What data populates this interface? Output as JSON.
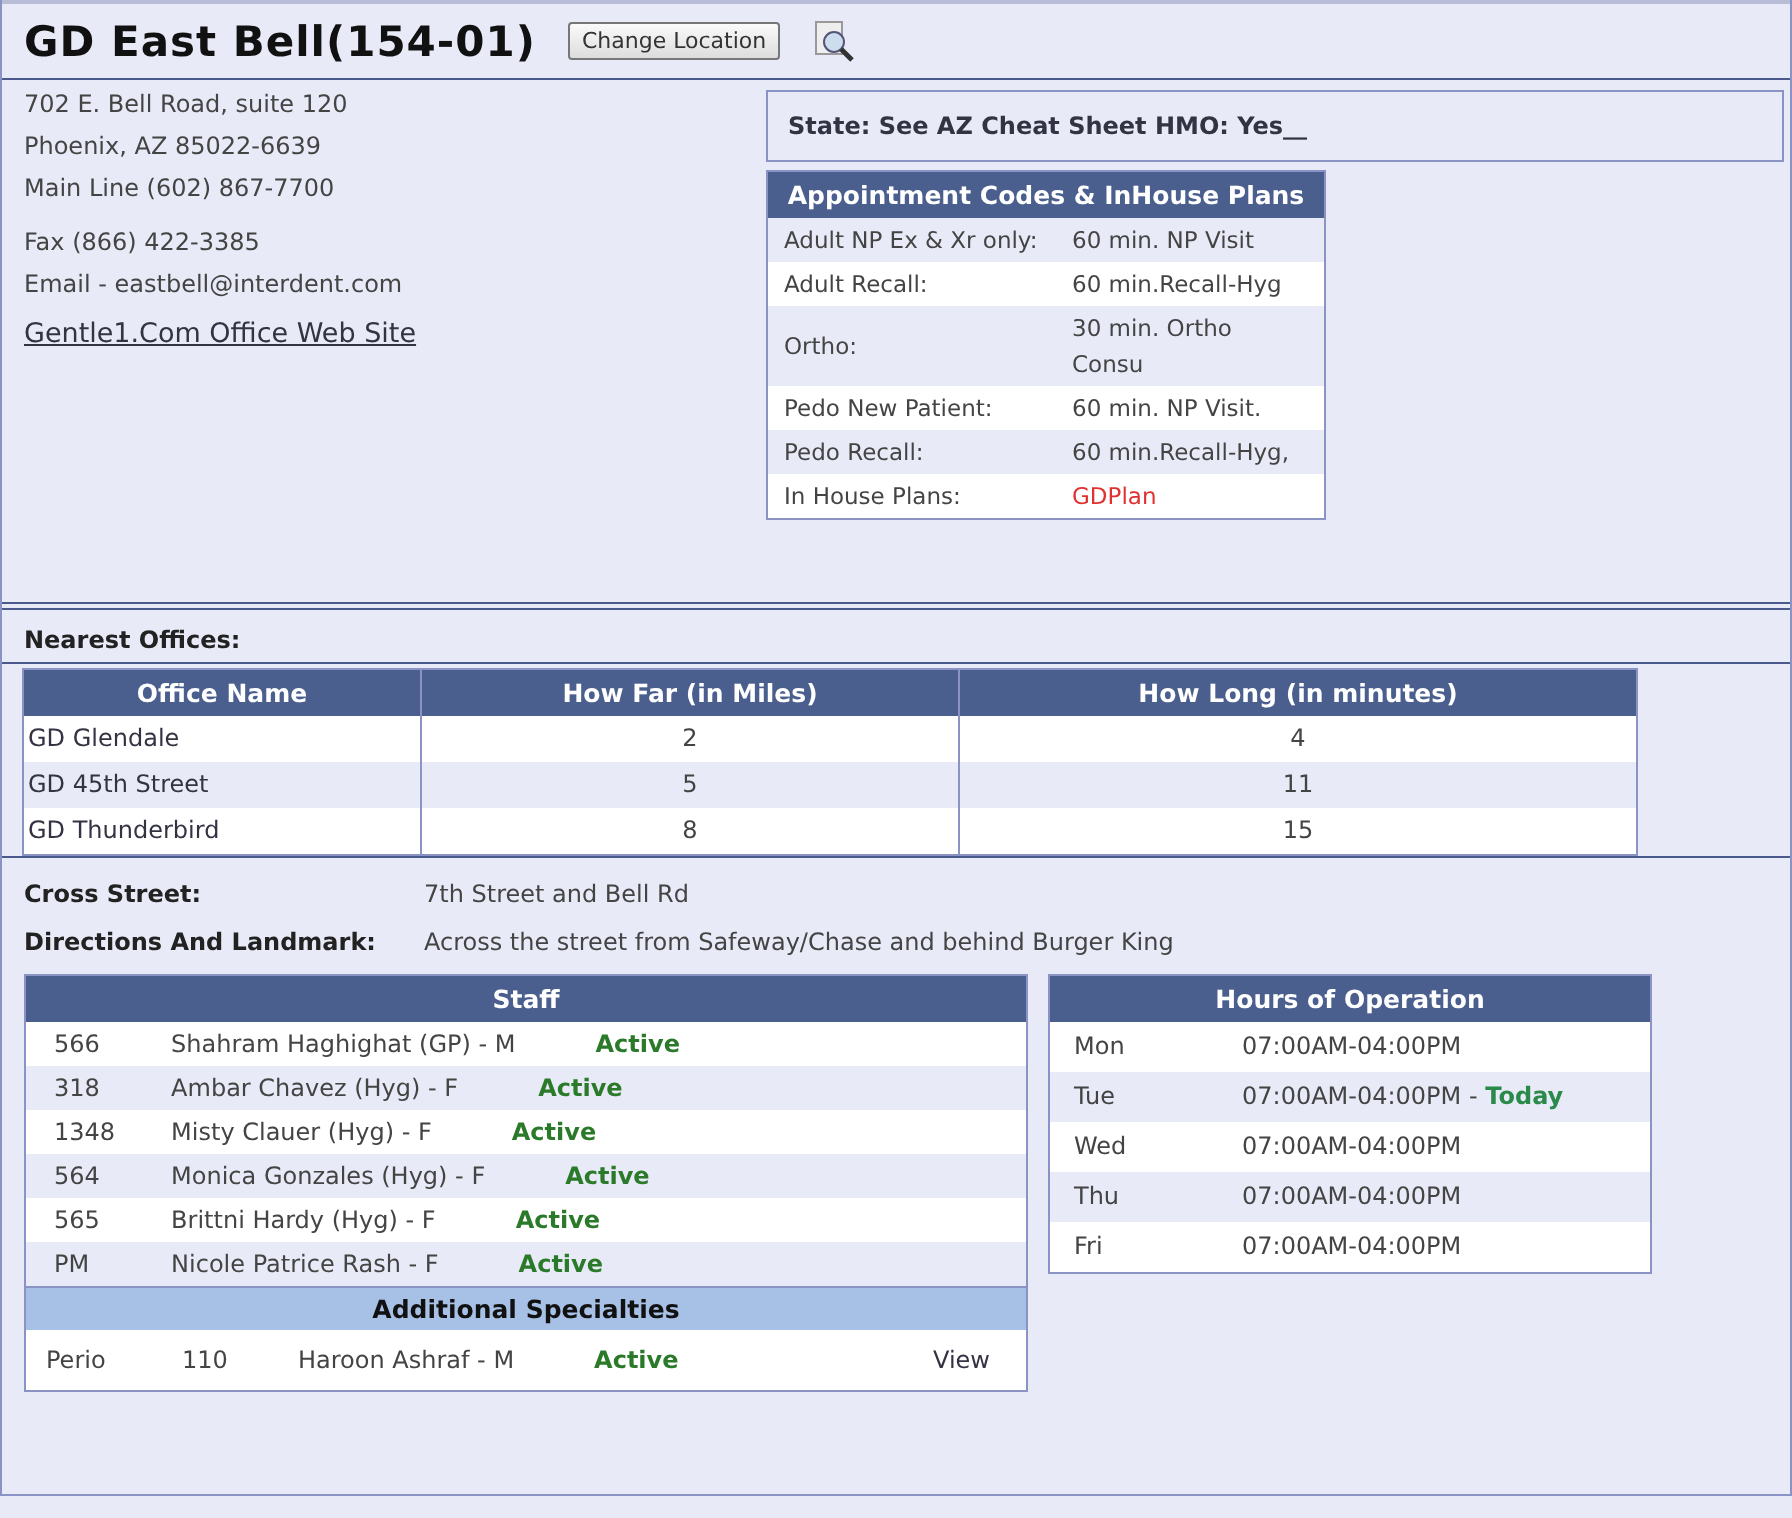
{
  "header": {
    "title": "GD East Bell(154-01)",
    "change_button": "Change Location"
  },
  "address": {
    "lines": [
      "702 E. Bell Road, suite 120",
      "Phoenix, AZ 85022-6639",
      "Main Line (602) 867-7700"
    ],
    "contact": [
      "Fax (866) 422-3385",
      "Email - eastbell@interdent.com"
    ],
    "website_link": "Gentle1.Com Office Web Site"
  },
  "state_note": "State: See AZ Cheat Sheet HMO: Yes__",
  "appointment_codes": {
    "title": "Appointment Codes & InHouse Plans",
    "rows": [
      {
        "label": "Adult NP Ex & Xr only:",
        "value": "60 min. NP Visit",
        "kind": "code"
      },
      {
        "label": "Adult Recall:",
        "value": "60 min.Recall-Hyg",
        "kind": "code"
      },
      {
        "label": "Ortho:",
        "value": "30 min. Ortho Consu",
        "kind": "code"
      },
      {
        "label": "Pedo New Patient:",
        "value": "60 min. NP Visit.",
        "kind": "code"
      },
      {
        "label": "Pedo Recall:",
        "value": "60 min.Recall-Hyg,",
        "kind": "code"
      },
      {
        "label": "In House Plans:",
        "value": "GDPlan",
        "kind": "plan"
      }
    ]
  },
  "nearest_offices": {
    "label": "Nearest Offices:",
    "columns": [
      "Office Name",
      "How Far (in Miles)",
      "How Long (in minutes)"
    ],
    "rows": [
      [
        "GD Glendale",
        "2",
        "4"
      ],
      [
        "GD 45th Street",
        "5",
        "11"
      ],
      [
        "GD Thunderbird",
        "8",
        "15"
      ]
    ]
  },
  "details": [
    {
      "label": "Cross Street:",
      "value": "7th Street and Bell Rd"
    },
    {
      "label": "Directions And Landmark:",
      "value": "Across the street from Safeway/Chase and behind Burger King"
    }
  ],
  "staff": {
    "title": "Staff",
    "rows": [
      {
        "id": "566",
        "name": "Shahram Haghighat (GP) - M",
        "status": "Active"
      },
      {
        "id": "318",
        "name": "Ambar Chavez (Hyg) - F",
        "status": "Active"
      },
      {
        "id": "1348",
        "name": "Misty Clauer (Hyg) - F",
        "status": "Active"
      },
      {
        "id": "564",
        "name": "Monica Gonzales (Hyg) - F",
        "status": "Active"
      },
      {
        "id": "565",
        "name": "Brittni Hardy (Hyg) - F",
        "status": "Active"
      },
      {
        "id": "PM",
        "name": "Nicole Patrice Rash - F",
        "status": "Active"
      }
    ]
  },
  "additional_specialties": {
    "title": "Additional Specialties",
    "rows": [
      {
        "specialty": "Perio",
        "id": "110",
        "name": "Haroon Ashraf - M",
        "status": "Active",
        "link": "View"
      }
    ]
  },
  "hours": {
    "title": "Hours of Operation",
    "today_separator": "-",
    "today_label": "Today",
    "rows": [
      {
        "day": "Mon",
        "hours": "07:00AM-04:00PM",
        "today": false
      },
      {
        "day": "Tue",
        "hours": "07:00AM-04:00PM",
        "today": true
      },
      {
        "day": "Wed",
        "hours": "07:00AM-04:00PM",
        "today": false
      },
      {
        "day": "Thu",
        "hours": "07:00AM-04:00PM",
        "today": false
      },
      {
        "day": "Fri",
        "hours": "07:00AM-04:00PM",
        "today": false
      }
    ]
  }
}
